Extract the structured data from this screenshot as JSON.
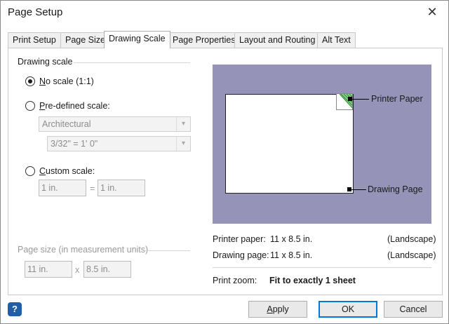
{
  "window": {
    "title": "Page Setup"
  },
  "tabs": [
    {
      "label": "Print Setup",
      "active": false
    },
    {
      "label": "Page Size",
      "active": false
    },
    {
      "label": "Drawing Scale",
      "active": true
    },
    {
      "label": "Page Properties",
      "active": false
    },
    {
      "label": "Layout and Routing",
      "active": false
    },
    {
      "label": "Alt Text",
      "active": false
    }
  ],
  "drawing_scale": {
    "group_label": "Drawing scale",
    "no_scale": {
      "mnemonic": "N",
      "rest": "o scale (1:1)",
      "checked": true
    },
    "predefined": {
      "mnemonic": "P",
      "rest": "re-defined scale:",
      "checked": false
    },
    "predefined_type": "Architectural",
    "predefined_value": "3/32\" = 1' 0\"",
    "custom": {
      "mnemonic": "C",
      "rest": "ustom scale:",
      "checked": false
    },
    "custom_left": "1 in.",
    "custom_equals": "=",
    "custom_right": "1 in."
  },
  "page_size": {
    "label": "Page size (in measurement units)",
    "width": "11 in.",
    "times": "x",
    "height": "8.5 in."
  },
  "preview": {
    "printer_paper_callout": "Printer Paper",
    "drawing_page_callout": "Drawing Page",
    "background_color": "#9693b8"
  },
  "info": {
    "printer_paper_label": "Printer paper:",
    "printer_paper_value": "11 x 8.5 in.",
    "printer_paper_orientation": "(Landscape)",
    "drawing_page_label": "Drawing page:",
    "drawing_page_value": "11 x 8.5 in.",
    "drawing_page_orientation": "(Landscape)",
    "print_zoom_label": "Print zoom:",
    "print_zoom_value": "Fit to exactly 1 sheet"
  },
  "footer": {
    "help_icon": "?",
    "apply": {
      "mnemonic": "A",
      "rest": "pply"
    },
    "ok": "OK",
    "cancel": "Cancel"
  }
}
